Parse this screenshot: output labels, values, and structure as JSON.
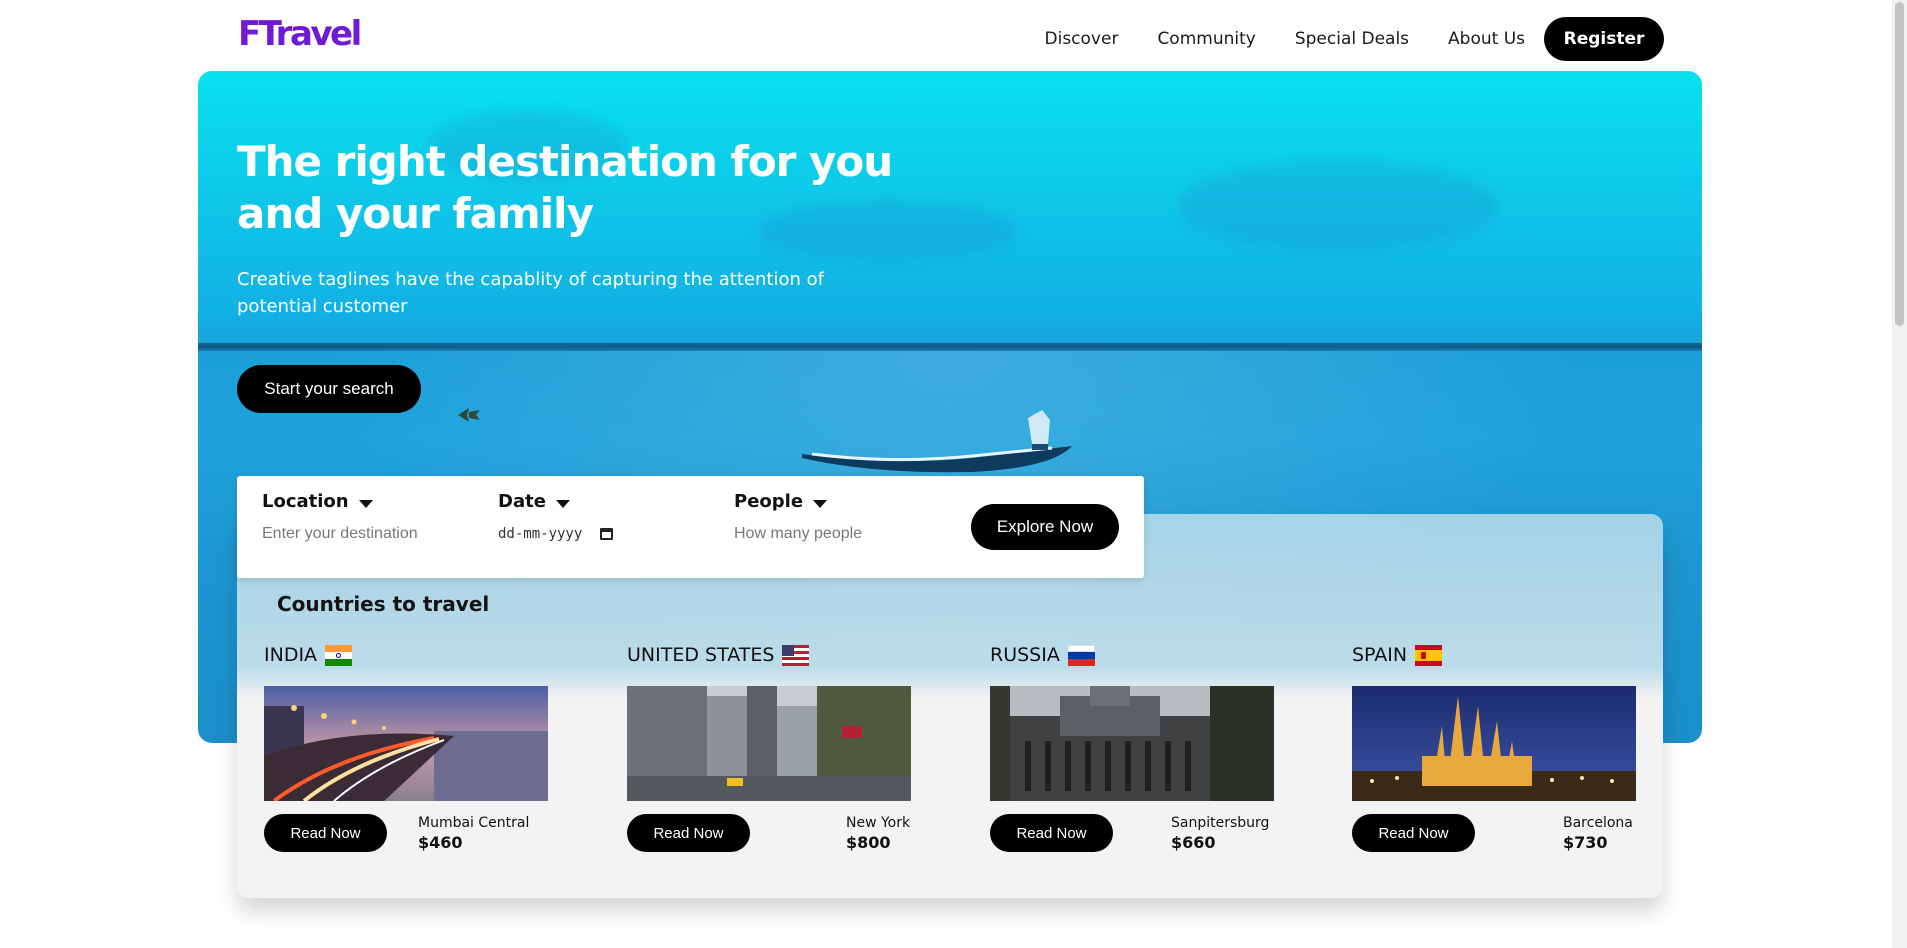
{
  "header": {
    "logo": "FTravel",
    "nav": [
      "Discover",
      "Community",
      "Special Deals",
      "About Us"
    ],
    "register_label": "Register"
  },
  "hero": {
    "title": "The right destination for you and your family",
    "tagline": "Creative taglines have the capablity of capturing the attention of potential customer",
    "cta_label": "Start your search"
  },
  "search": {
    "location": {
      "label": "Location",
      "placeholder": "Enter your destination"
    },
    "date": {
      "label": "Date",
      "value": "dd-mm-yyyy"
    },
    "people": {
      "label": "People",
      "placeholder": "How many people"
    },
    "submit_label": "Explore Now"
  },
  "countries": {
    "title": "Countries to travel",
    "items": [
      {
        "name": "INDIA",
        "city": "Mumbai Central",
        "price": "$460",
        "button": "Read Now"
      },
      {
        "name": "UNITED STATES",
        "city": "New York",
        "price": "$800",
        "button": "Read Now"
      },
      {
        "name": "RUSSIA",
        "city": "Sanpitersburg",
        "price": "$660",
        "button": "Read Now"
      },
      {
        "name": "SPAIN",
        "city": "Barcelona",
        "price": "$730",
        "button": "Read Now"
      }
    ]
  },
  "colors": {
    "brand": "#6f1bd6",
    "button": "#000000",
    "hero_sky": "#08e1ee",
    "hero_sea": "#1e9fd9"
  }
}
